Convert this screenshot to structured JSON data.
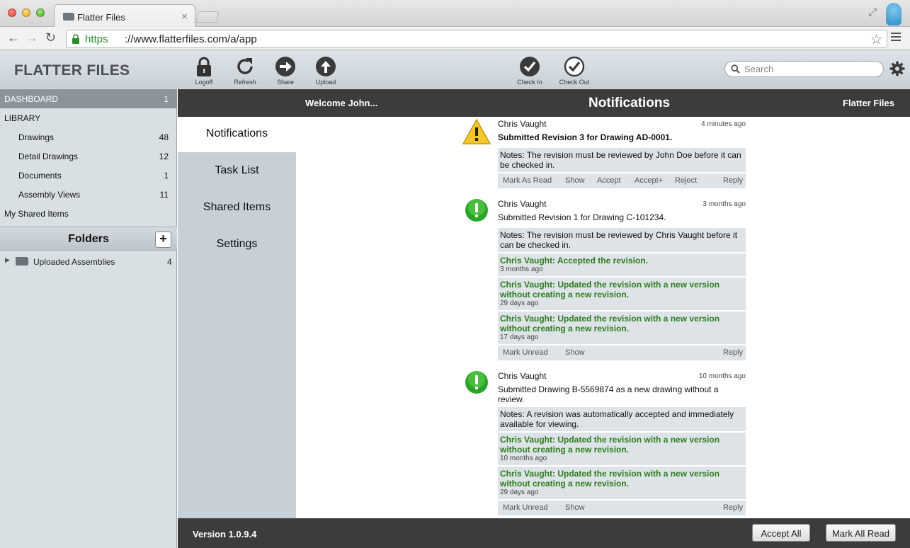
{
  "browser": {
    "tab_title": "Flatter Files",
    "tab_close": "×",
    "url_scheme": "https",
    "url_rest": "://www.flatterfiles.com/a/app"
  },
  "app": {
    "brand": "FLATTER FILES",
    "toolbar": {
      "logoff": "Logoff",
      "refresh": "Refresh",
      "share": "Share",
      "upload": "Upload",
      "check_in": "Check In",
      "check_out": "Check Out"
    },
    "search_placeholder": "Search"
  },
  "sidebar": {
    "dashboard": {
      "label": "DASHBOARD",
      "count": "1"
    },
    "library": {
      "label": "LIBRARY"
    },
    "library_items": [
      {
        "label": "Drawings",
        "count": "48"
      },
      {
        "label": "Detail Drawings",
        "count": "12"
      },
      {
        "label": "Documents",
        "count": "1"
      },
      {
        "label": "Assembly Views",
        "count": "11"
      }
    ],
    "shared": {
      "label": "My Shared Items"
    },
    "folders_title": "Folders",
    "add_folder": "+",
    "folders": [
      {
        "label": "Uploaded Assemblies",
        "count": "4"
      }
    ]
  },
  "main": {
    "welcome": "Welcome John...",
    "title": "Notifications",
    "brand_right": "Flatter Files",
    "subnav": [
      "Notifications",
      "Task List",
      "Shared Items",
      "Settings"
    ]
  },
  "notifications": [
    {
      "icon": "warning-icon",
      "author": "Chris Vaught",
      "time": "4 minutes ago",
      "text": "Submitted Revision 3 for Drawing AD-0001.",
      "note": "Notes:  The revision must be reviewed by John Doe before it can be checked in.",
      "actions": [
        "Mark As Read",
        "Show",
        "Accept",
        "Accept+",
        "Reject",
        "Reply"
      ]
    },
    {
      "icon": "check-icon",
      "author": "Chris Vaught",
      "time": "3 months ago",
      "text": "Submitted Revision 1 for Drawing C-101234.",
      "note": "Notes:  The revision must be reviewed by Chris Vaught before it can be checked in.",
      "events": [
        {
          "text": "Chris Vaught:  Accepted the revision.",
          "ago": "3 months ago"
        },
        {
          "text": "Chris Vaught:  Updated the revision with a new version without creating a new revision.",
          "ago": "29 days ago"
        },
        {
          "text": "Chris Vaught:  Updated the revision with a new version without creating a new revision.",
          "ago": "17 days ago"
        }
      ],
      "actions": [
        "Mark Unread",
        "Show",
        "Reply"
      ]
    },
    {
      "icon": "check-icon",
      "author": "Chris Vaught",
      "time": "10 months ago",
      "text": "Submitted Drawing B-5569874 as a new drawing without a review.",
      "note": "Notes:  A revision was automatically accepted and immediately available for viewing.",
      "events": [
        {
          "text": "Chris Vaught:  Updated the revision with a new version without creating a new revision.",
          "ago": "10 months ago"
        },
        {
          "text": "Chris Vaught:  Updated the revision with a new version without creating a new revision.",
          "ago": "29 days ago"
        }
      ],
      "actions": [
        "Mark Unread",
        "Show",
        "Reply"
      ]
    }
  ],
  "footer": {
    "version": "Version 1.0.9.4",
    "accept_all": "Accept All",
    "mark_all_read": "Mark All Read"
  }
}
